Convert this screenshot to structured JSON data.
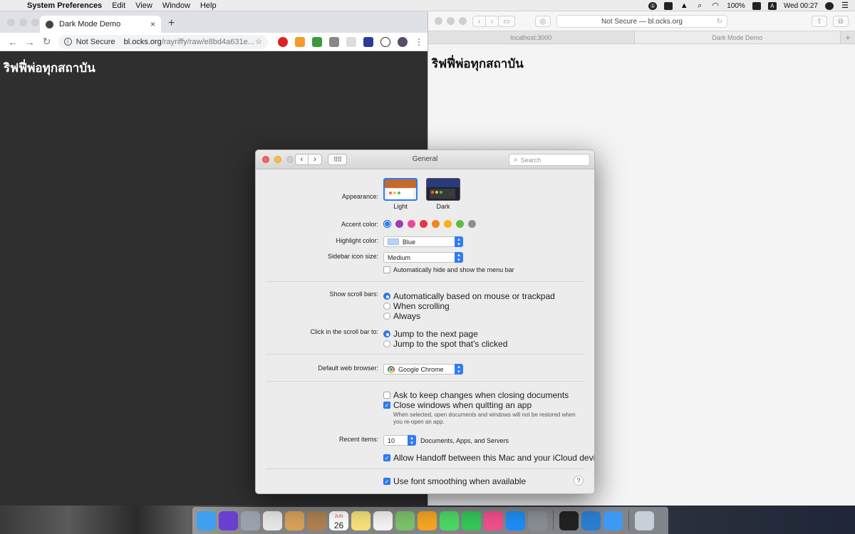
{
  "menubar": {
    "app_name": "System Preferences",
    "menus": [
      "Edit",
      "View",
      "Window",
      "Help"
    ],
    "battery": "100%",
    "input_source": "A",
    "clock": "Wed 00:27"
  },
  "chrome": {
    "tab_title": "Dark Mode Demo",
    "security": "Not Secure",
    "url_host": "bl.ocks.org",
    "url_path": "/rayriffy/raw/e8bd4a631e...",
    "heading": "ริฟฟี่พ่อทุกสถาบัน"
  },
  "safari": {
    "address": "Not Secure — bl.ocks.org",
    "tabs": [
      "localhost:3000",
      "Dark Mode Demo"
    ],
    "heading": "ริฟฟี่พ่อทุกสถาบัน"
  },
  "prefs": {
    "title": "General",
    "search_placeholder": "Search",
    "appearance": {
      "label": "Appearance:",
      "options": [
        "Light",
        "Dark"
      ],
      "selected": "Light"
    },
    "accent": {
      "label": "Accent color:",
      "colors": [
        "#2f7bf5",
        "#9b3fb0",
        "#f0449d",
        "#e0393e",
        "#f6821f",
        "#f9b01c",
        "#5bbf3a",
        "#8e8e8e"
      ],
      "selected_index": 0
    },
    "highlight": {
      "label": "Highlight color:",
      "value": "Blue",
      "chip_color": "#b3d4fd"
    },
    "sidebar_size": {
      "label": "Sidebar icon size:",
      "value": "Medium"
    },
    "auto_hide_menu": {
      "label": "Automatically hide and show the menu bar",
      "checked": false
    },
    "scroll_bars": {
      "label": "Show scroll bars:",
      "options": [
        "Automatically based on mouse or trackpad",
        "When scrolling",
        "Always"
      ],
      "selected_index": 0
    },
    "click_scroll": {
      "label": "Click in the scroll bar to:",
      "options": [
        "Jump to the next page",
        "Jump to the spot that's clicked"
      ],
      "selected_index": 0
    },
    "browser": {
      "label": "Default web browser:",
      "value": "Google Chrome"
    },
    "ask_keep_changes": {
      "label": "Ask to keep changes when closing documents",
      "checked": false
    },
    "close_windows": {
      "label": "Close windows when quitting an app",
      "checked": true,
      "note": "When selected, open documents and windows will not be restored when you re-open an app."
    },
    "recent_items": {
      "label": "Recent items:",
      "value": "10",
      "suffix": "Documents, Apps, and Servers"
    },
    "handoff": {
      "label": "Allow Handoff between this Mac and your iCloud devices",
      "checked": true
    },
    "font_smoothing": {
      "label": "Use font smoothing when available",
      "checked": true
    },
    "help": "?"
  },
  "dock": {
    "apps": [
      {
        "name": "finder-icon",
        "color": "#3fa0f0"
      },
      {
        "name": "siri-icon",
        "color": "#6b3fd0"
      },
      {
        "name": "launchpad-icon",
        "color": "#9aa4b0"
      },
      {
        "name": "chrome-icon",
        "color": "#e8e8e8"
      },
      {
        "name": "preview-icon",
        "color": "#d9a25a"
      },
      {
        "name": "contacts-icon",
        "color": "#b08050"
      },
      {
        "name": "calendar-icon",
        "color": "#ffffff"
      },
      {
        "name": "notes-icon",
        "color": "#f7e27a"
      },
      {
        "name": "reminders-icon",
        "color": "#f4f4f4"
      },
      {
        "name": "maps-icon",
        "color": "#7cc36a"
      },
      {
        "name": "photos-icon",
        "color": "#f5a623"
      },
      {
        "name": "messages-icon",
        "color": "#4cd964"
      },
      {
        "name": "facetime-icon",
        "color": "#35c759"
      },
      {
        "name": "itunes-icon",
        "color": "#f2508c"
      },
      {
        "name": "app-store-icon",
        "color": "#1e8ef5"
      },
      {
        "name": "system-preferences-icon",
        "color": "#8a8f96"
      },
      {
        "name": "terminal-icon",
        "color": "#222222"
      },
      {
        "name": "vscode-icon",
        "color": "#2a7fd1"
      },
      {
        "name": "safari-icon",
        "color": "#3f9af3"
      },
      {
        "name": "trash-icon",
        "color": "#c9cfd6"
      }
    ],
    "calendar_month": "JUN",
    "calendar_day": "26"
  }
}
